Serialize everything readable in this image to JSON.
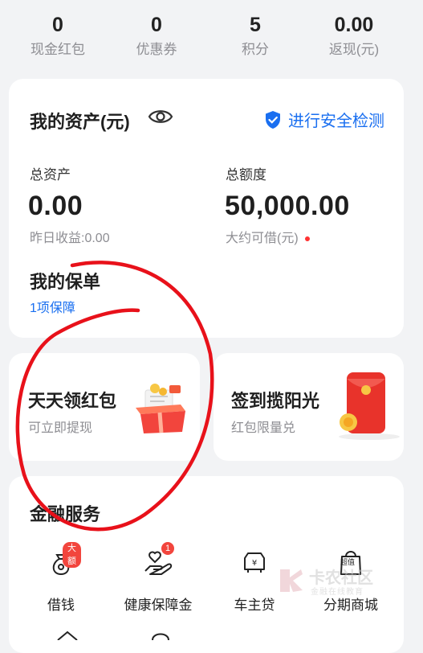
{
  "stats": [
    {
      "value": "0",
      "label": "现金红包"
    },
    {
      "value": "0",
      "label": "优惠券"
    },
    {
      "value": "5",
      "label": "积分"
    },
    {
      "value": "0.00",
      "label": "返现(元)"
    }
  ],
  "assets": {
    "title": "我的资产(元)",
    "security_label": "进行安全检测",
    "total_assets_label": "总资产",
    "total_assets_value": "0.00",
    "yesterday_earnings": "昨日收益:0.00",
    "credit_label": "总额度",
    "credit_value": "50,000.00",
    "borrowable": "大约可借(元)",
    "policy_title": "我的保单",
    "policy_link": "1项保障"
  },
  "promos": [
    {
      "title": "天天领红包",
      "subtitle": "可立即提现"
    },
    {
      "title": "签到揽阳光",
      "subtitle": "红包限量兑"
    }
  ],
  "finance": {
    "title": "金融服务",
    "services": [
      {
        "label": "借钱",
        "badge": "大额",
        "icon": "money-bag-icon"
      },
      {
        "label": "健康保障金",
        "badge": "1",
        "icon": "hand-heart-icon"
      },
      {
        "label": "车主贷",
        "icon": "car-loan-icon"
      },
      {
        "label": "分期商城",
        "icon": "shopping-bag-icon",
        "tag": "超值"
      }
    ]
  },
  "watermark": {
    "main": "卡农社区",
    "sub": "金融在线教育"
  },
  "colors": {
    "accent": "#1a6ff0",
    "red": "#f2453d",
    "annotation": "#e8111a"
  }
}
